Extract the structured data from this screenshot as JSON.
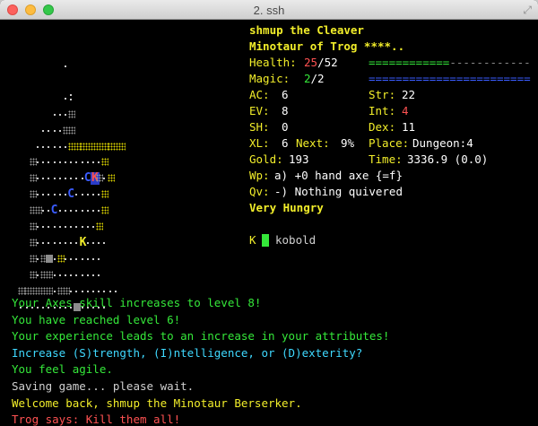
{
  "window": {
    "title": "2. ssh"
  },
  "stats": {
    "player_name": "shmup the Cleaver",
    "species_god": "Minotaur of Trog ****..",
    "health": {
      "label": "Health:",
      "current": "25",
      "max": "/52"
    },
    "magic": {
      "label": "Magic:",
      "current": "2",
      "max": "/2"
    },
    "ac": {
      "label": "AC:",
      "value": "6"
    },
    "ev": {
      "label": "EV:",
      "value": "8"
    },
    "sh": {
      "label": "SH:",
      "value": "0"
    },
    "xl": {
      "label": "XL:",
      "value": "6",
      "next_label": "Next:",
      "next_value": "9%"
    },
    "gold": {
      "label": "Gold:",
      "value": "193"
    },
    "str": {
      "label": "Str:",
      "value": "22"
    },
    "int": {
      "label": "Int:",
      "value": "4"
    },
    "dex": {
      "label": "Dex:",
      "value": "11"
    },
    "place": {
      "label": "Place:",
      "value": "Dungeon:4"
    },
    "time": {
      "label": "Time:",
      "value": "3336.9 (0.0)"
    },
    "weapon": {
      "label": "Wp:",
      "value": "a) +0 hand axe {=f}"
    },
    "quiver": {
      "label": "Qv:",
      "value": "-) Nothing quivered"
    },
    "status": "Very Hungry",
    "health_fraction": 0.48,
    "magic_fraction": 1.0
  },
  "monsters": [
    {
      "glyph": "K",
      "name": "kobold"
    }
  ],
  "messages": [
    {
      "text": "Your Axes skill increases to level 8!",
      "color": "#35e83a"
    },
    {
      "text": "You have reached level 6!",
      "color": "#35e83a"
    },
    {
      "text": "Your experience leads to an increase in your attributes!",
      "color": "#35e83a"
    },
    {
      "text": "Increase (S)trength, (I)ntelligence, or (D)exterity?",
      "color": "#3fd9ff"
    },
    {
      "text": "You feel agile.",
      "color": "#35e83a"
    },
    {
      "text": "Saving game... please wait.",
      "color": "#d0d0d0"
    },
    {
      "text": "Welcome back, shmup the Minotaur Berserker.",
      "color": "#f2ee2a"
    },
    {
      "text": "Trog says: Kill them all!",
      "color": "#ff5252"
    }
  ],
  "map_glyphs": {
    "kobold": "K",
    "player": "K",
    "door_a": "C",
    "door_b": "C",
    "door_c": "C"
  },
  "colors": {
    "health_bar": "#35e83a",
    "magic_bar": "#3a5cff",
    "bar_empty": "#8a8a8a"
  }
}
